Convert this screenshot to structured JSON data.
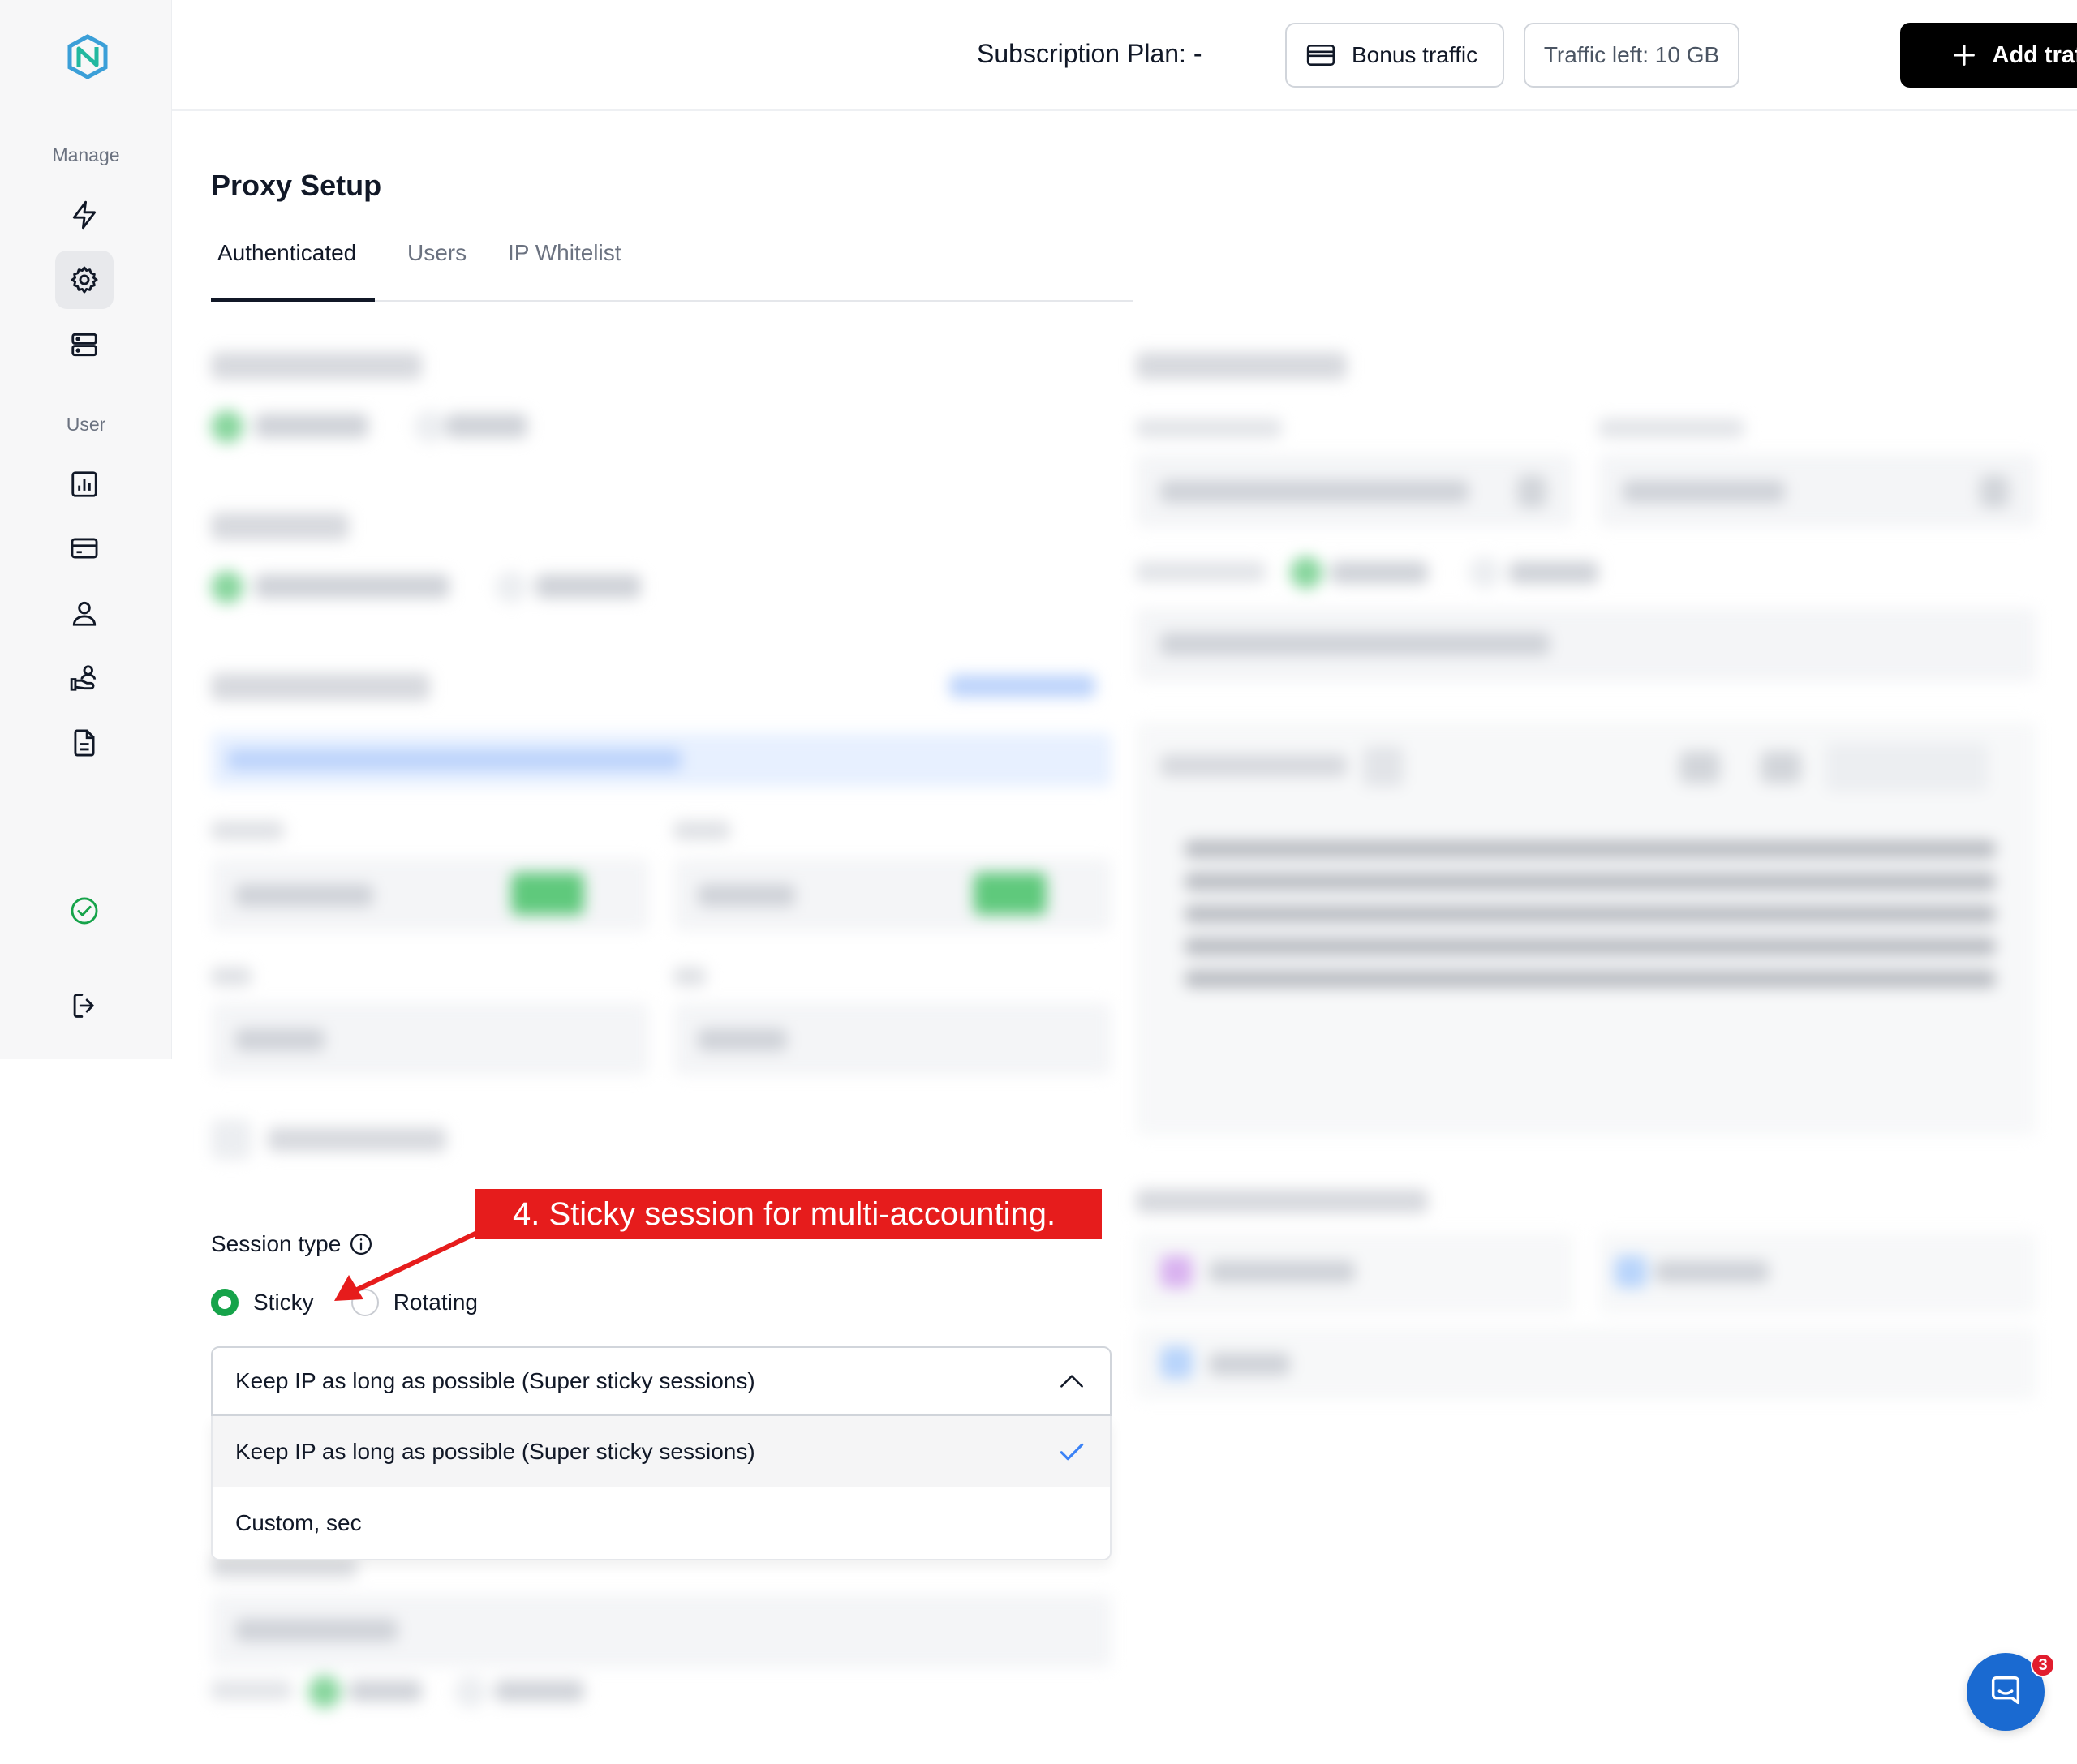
{
  "sidebar": {
    "sections": [
      {
        "label": "Manage"
      },
      {
        "label": "User"
      }
    ],
    "manage_items": [
      {
        "icon": "bolt-icon"
      },
      {
        "icon": "gear-icon",
        "active": true
      },
      {
        "icon": "server-icon"
      }
    ],
    "user_items": [
      {
        "icon": "chart-icon"
      },
      {
        "icon": "credit-card-icon"
      },
      {
        "icon": "user-icon"
      },
      {
        "icon": "referral-icon"
      },
      {
        "icon": "document-icon"
      }
    ],
    "status_icon": "check-circle-icon",
    "logout_icon": "logout-icon"
  },
  "header": {
    "subscription": "Subscription Plan: -",
    "bonus_traffic": "Bonus traffic",
    "traffic_left": "Traffic left: 10 GB",
    "add_traffic": "Add traffic"
  },
  "page": {
    "title": "Proxy Setup",
    "tabs": [
      {
        "label": "Authenticated",
        "active": true
      },
      {
        "label": "Users"
      },
      {
        "label": "IP Whitelist"
      }
    ]
  },
  "session": {
    "label": "Session type",
    "options": [
      {
        "label": "Sticky",
        "selected": true
      },
      {
        "label": "Rotating",
        "selected": false
      }
    ],
    "dropdown": {
      "value": "Keep IP as long as possible (Super sticky sessions)",
      "items": [
        {
          "label": "Keep IP as long as possible (Super sticky sessions)",
          "selected": true
        },
        {
          "label": "Custom, sec",
          "selected": false
        }
      ]
    }
  },
  "annotation": {
    "text": "4. Sticky session for multi-accounting."
  },
  "chat": {
    "badge": "3"
  },
  "colors": {
    "accent": "#16a34a",
    "primary_button": "#000000",
    "annotation": "#e61c1c",
    "chat": "#1a6ad1",
    "check": "#3b82f6"
  }
}
